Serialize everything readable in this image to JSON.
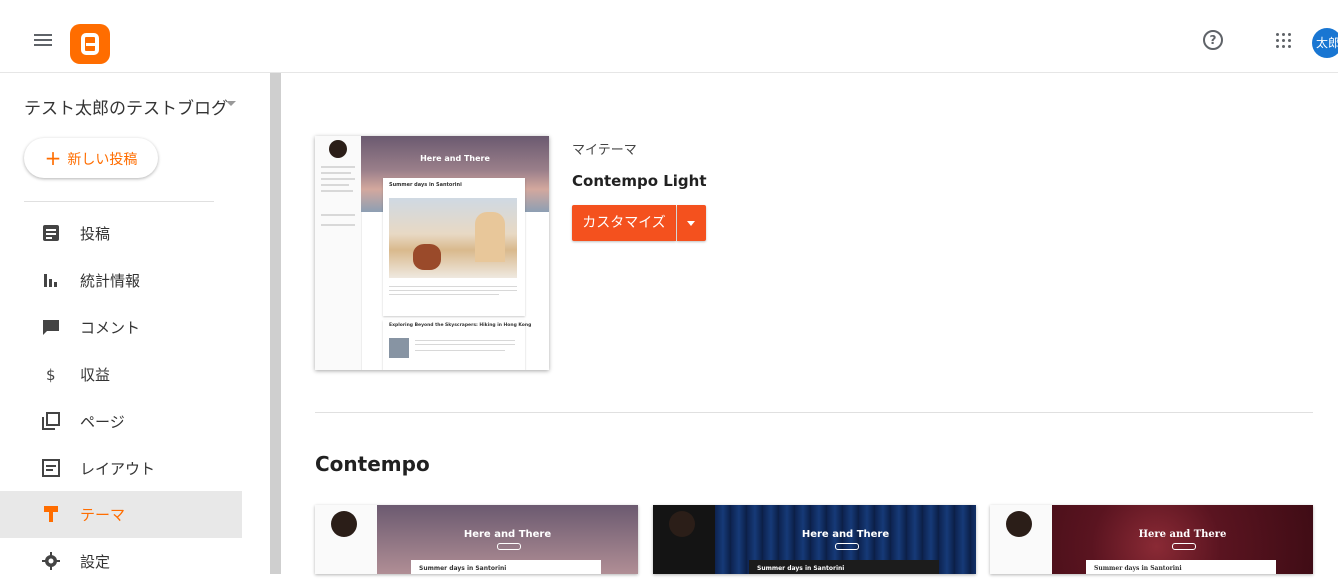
{
  "header": {
    "menu_icon": "hamburger-menu-icon",
    "logo_icon": "blogger-logo-icon",
    "help_icon": "help-circle-icon",
    "help_glyph": "?",
    "apps_icon": "apps-grid-icon",
    "avatar_text": "太郎",
    "accent_color": "#ff6d00"
  },
  "sidebar": {
    "blog_name": "テスト太郎のテストブログ",
    "new_post_label": "新しい投稿",
    "items": [
      {
        "label": "投稿",
        "icon": "posts-icon"
      },
      {
        "label": "統計情報",
        "icon": "stats-icon"
      },
      {
        "label": "コメント",
        "icon": "comment-icon"
      },
      {
        "label": "収益",
        "icon": "dollar-icon"
      },
      {
        "label": "ページ",
        "icon": "pages-icon"
      },
      {
        "label": "レイアウト",
        "icon": "layout-icon"
      },
      {
        "label": "テーマ",
        "icon": "theme-icon",
        "active": true
      },
      {
        "label": "設定",
        "icon": "gear-icon"
      }
    ]
  },
  "current_theme": {
    "section_label": "マイテーマ",
    "name": "Contempo Light",
    "customize_label": "カスタマイズ",
    "preview": {
      "blog_title": "Here and There",
      "post1_title": "Summer days in Santorini",
      "post2_title": "Exploring Beyond the Skyscrapers: Hiking in Hong Kong"
    }
  },
  "theme_gallery": {
    "section_title": "Contempo",
    "themes": [
      {
        "blog_title": "Here and There",
        "post_title": "Summer days in Santorini",
        "hero_color": "#8a6f82"
      },
      {
        "blog_title": "Here and There",
        "post_title": "Summer days in Santorini",
        "hero_color": "#0f2a55"
      },
      {
        "blog_title": "Here and There",
        "post_title": "Summer days in Santorini",
        "hero_color": "#5a1420"
      }
    ]
  }
}
